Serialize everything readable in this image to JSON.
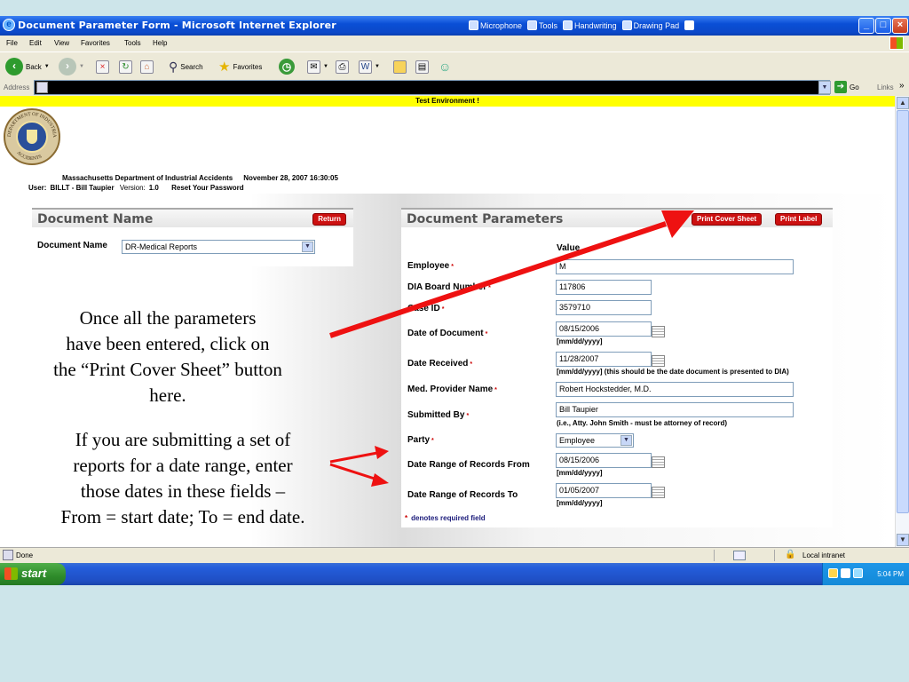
{
  "window": {
    "title": "Document Parameter Form - Microsoft Internet Explorer",
    "language_bar": [
      "Microphone",
      "Tools",
      "Handwriting",
      "Drawing Pad"
    ]
  },
  "menubar": [
    "File",
    "Edit",
    "View",
    "Favorites",
    "Tools",
    "Help"
  ],
  "toolbar": {
    "back_label": "Back",
    "search_label": "Search",
    "favorites_label": "Favorites"
  },
  "addressbar": {
    "label": "Address",
    "go_label": "Go",
    "links_label": "Links"
  },
  "page": {
    "env_banner": "Test Environment !",
    "dept": "Massachusetts Department of Industrial Accidents",
    "datetime": "November 28, 2007 16:30:05",
    "user_label": "User:",
    "user_value": "BILLT - Bill Taupier",
    "version_label": "Version:",
    "version_value": "1.0",
    "reset_link": "Reset Your Password",
    "seal_text_top": "DEPARTMENT OF INDUSTRIAL",
    "seal_text_bottom": "ACCIDENTS"
  },
  "doc_name_panel": {
    "title": "Document Name",
    "return_button": "Return",
    "field_label": "Document Name",
    "field_value": "DR-Medical Reports"
  },
  "doc_params_panel": {
    "title": "Document Parameters",
    "print_cover_button": "Print Cover Sheet",
    "print_label_button": "Print Label",
    "value_header": "Value",
    "fields": {
      "employee": {
        "label": "Employee",
        "value": "M"
      },
      "dia_board": {
        "label": "DIA Board Number",
        "value": "117806"
      },
      "case_id": {
        "label": "Case ID",
        "value": "3579710"
      },
      "date_of_doc": {
        "label": "Date of Document",
        "value": "08/15/2006",
        "hint": "[mm/dd/yyyy]"
      },
      "date_received": {
        "label": "Date Received",
        "value": "11/28/2007",
        "hint": "[mm/dd/yyyy] (this should be the date document is presented to DIA)"
      },
      "provider": {
        "label": "Med. Provider Name",
        "value": "Robert Hockstedder, M.D."
      },
      "submitted_by": {
        "label": "Submitted By",
        "value": "Bill Taupier",
        "hint": "(i.e., Atty. John Smith - must be attorney of record)"
      },
      "party": {
        "label": "Party",
        "value": "Employee"
      },
      "range_from": {
        "label": "Date Range of Records From",
        "value": "08/15/2006",
        "hint": "[mm/dd/yyyy]"
      },
      "range_to": {
        "label": "Date Range of Records To",
        "value": "01/05/2007",
        "hint": "[mm/dd/yyyy]"
      }
    },
    "required_note": "denotes required field",
    "required_mark": "*"
  },
  "annotations": {
    "note1": [
      "Once all the parameters",
      "have been entered, click on",
      "the “Print Cover Sheet” button",
      "here."
    ],
    "note2": [
      "If you are submitting a set of",
      "reports for a date range, enter",
      "those dates in these fields –",
      "From = start date; To = end date."
    ]
  },
  "statusbar": {
    "status": "Done",
    "zone": "Local intranet"
  },
  "taskbar": {
    "start": "start",
    "clock": "5:04 PM"
  },
  "colors": {
    "accent_red": "#cc1111",
    "arrow_red": "#ee1111",
    "banner_yellow": "#ffff00",
    "titlebar_blue": "#0a4fd6",
    "slide_bg": "#cde5ea"
  }
}
